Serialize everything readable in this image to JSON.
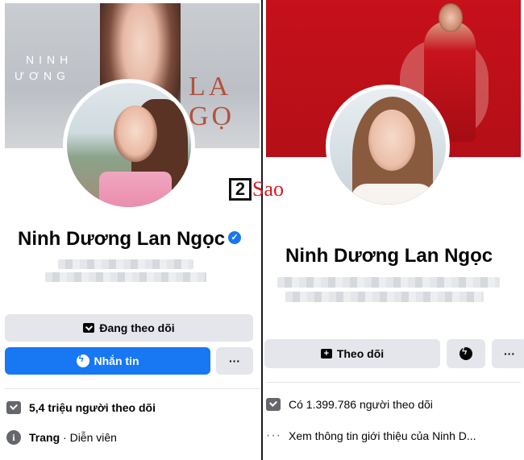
{
  "left": {
    "cover_text_line1": "NINH",
    "cover_text_line2": "ƯƠNG",
    "cover_big_line1": "LA",
    "cover_big_line2": "GỌ",
    "profile_name": "Ninh Dương Lan Ngọc",
    "following_button": "Đang theo dõi",
    "message_button": "Nhắn tin",
    "more_button": "···",
    "followers": "5,4 triệu người theo dõi",
    "page_label": "Trang",
    "page_separator": "·",
    "page_category": "Diễn viên"
  },
  "right": {
    "profile_name": "Ninh Dương Lan Ngọc",
    "follow_button": "Theo dõi",
    "more_button": "···",
    "followers": "Có 1.399.786 người theo dõi",
    "about_link": "Xem thông tin giới thiệu của Ninh D..."
  },
  "watermark": {
    "number": "2",
    "text": "Sao"
  },
  "colors": {
    "facebook_blue": "#1877f2",
    "button_grey": "#e4e6eb",
    "cover_red": "#c6101a"
  }
}
